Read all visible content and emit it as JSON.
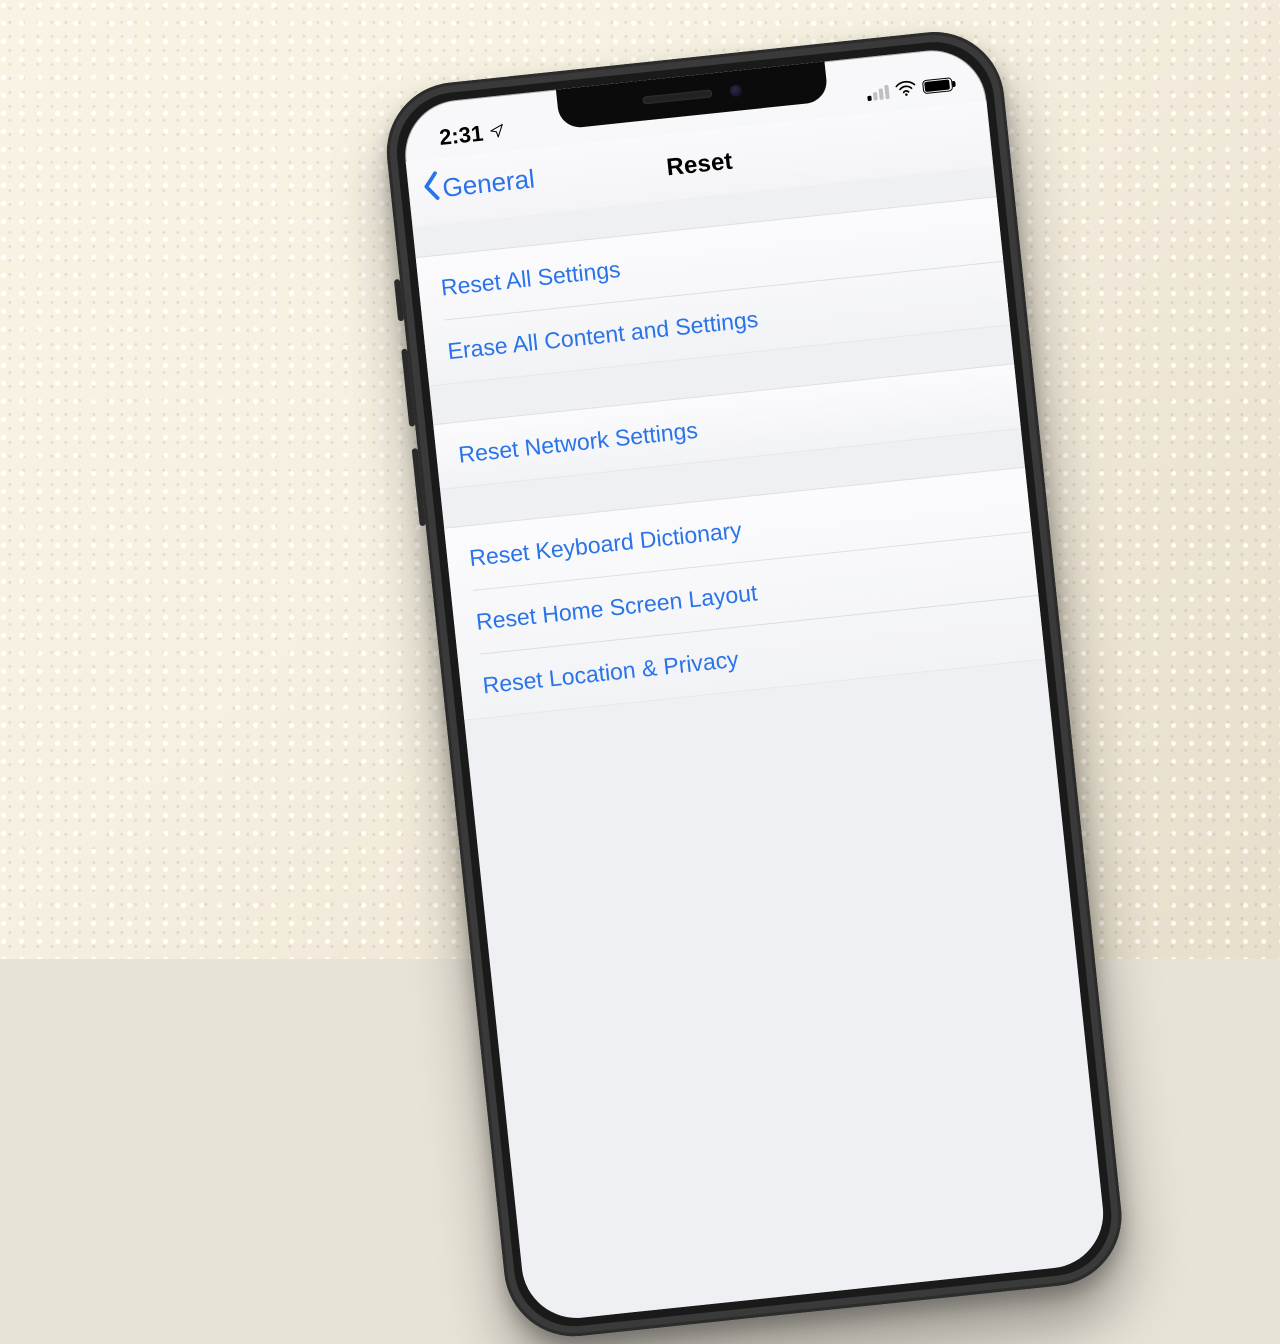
{
  "status": {
    "time": "2:31",
    "location_services": true,
    "cellular_active_bars": 1
  },
  "nav": {
    "back_label": "General",
    "title": "Reset"
  },
  "colors": {
    "accent": "#2a73e8"
  },
  "groups": [
    {
      "rows": [
        {
          "label": "Reset All Settings"
        },
        {
          "label": "Erase All Content and Settings"
        }
      ]
    },
    {
      "rows": [
        {
          "label": "Reset Network Settings"
        }
      ]
    },
    {
      "rows": [
        {
          "label": "Reset Keyboard Dictionary"
        },
        {
          "label": "Reset Home Screen Layout"
        },
        {
          "label": "Reset Location & Privacy"
        }
      ]
    }
  ]
}
